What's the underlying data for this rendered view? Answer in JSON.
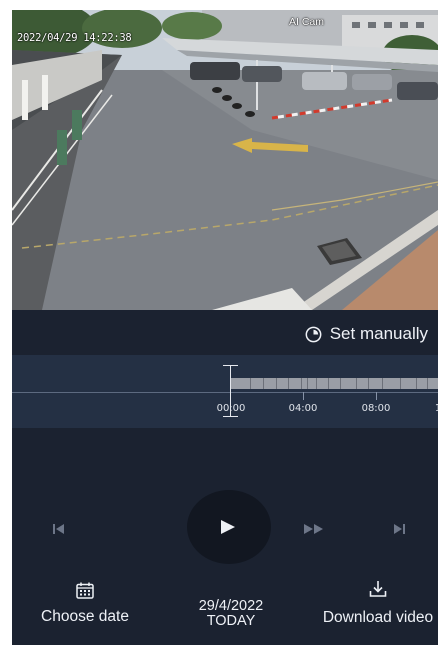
{
  "camera": {
    "timestamp": "2022/04/29 14:22:38",
    "name": "AI Cam"
  },
  "mode": {
    "set_manually_label": "Set manually",
    "icon": "clock-icon"
  },
  "timeline": {
    "labels": [
      "00:00",
      "04:00",
      "08:00",
      "1"
    ],
    "recording_start_fraction": 0.0
  },
  "controls": {
    "prev_icon": "skip-previous-icon",
    "play_icon": "play-icon",
    "fast_forward_icon": "fast-forward-icon",
    "next_icon": "skip-next-icon"
  },
  "actions": {
    "choose_date_label": "Choose date",
    "date": "29/4/2022",
    "date_sub": "TODAY",
    "download_label": "Download video"
  },
  "colors": {
    "background": "#1b2230",
    "timeline": "#243044",
    "play_circle": "#121721",
    "text": "#eef1f6"
  }
}
